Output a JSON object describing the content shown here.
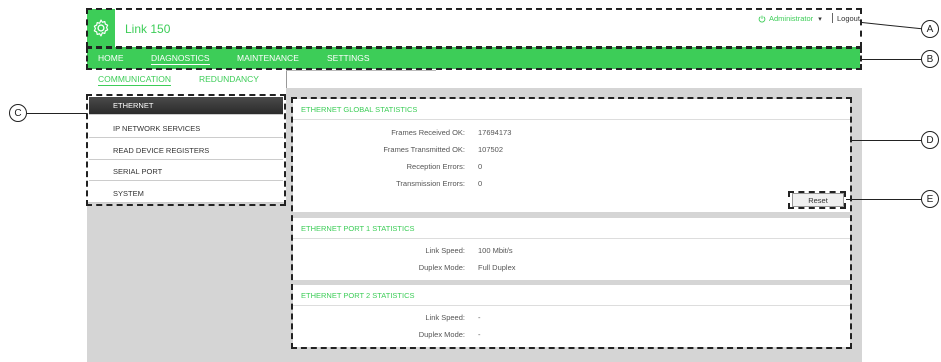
{
  "header": {
    "title": "Link 150",
    "user": "Administrator",
    "logout": "Logout",
    "icons": {
      "logo": "gear-icon",
      "user": "user-power-icon",
      "caret": "caret-down-icon"
    }
  },
  "nav": {
    "items": [
      "HOME",
      "DIAGNOSTICS",
      "MAINTENANCE",
      "SETTINGS"
    ],
    "active": "DIAGNOSTICS"
  },
  "subtabs": {
    "items": [
      "COMMUNICATION",
      "REDUNDANCY"
    ],
    "active": "COMMUNICATION"
  },
  "sidebar": {
    "items": [
      "ETHERNET",
      "IP NETWORK SERVICES",
      "READ DEVICE REGISTERS",
      "SERIAL PORT",
      "SYSTEM"
    ],
    "active": "ETHERNET"
  },
  "global_stats": {
    "title": "ETHERNET GLOBAL STATISTICS",
    "rows": [
      {
        "label": "Frames Received OK:",
        "value": "17694173"
      },
      {
        "label": "Frames Transmitted OK:",
        "value": "107502"
      },
      {
        "label": "Reception Errors:",
        "value": "0"
      },
      {
        "label": "Transmission Errors:",
        "value": "0"
      }
    ],
    "reset_label": "Reset"
  },
  "port1": {
    "title": "ETHERNET PORT 1 STATISTICS",
    "rows": [
      {
        "label": "Link Speed:",
        "value": "100 Mbit/s"
      },
      {
        "label": "Duplex Mode:",
        "value": "Full Duplex"
      }
    ]
  },
  "port2": {
    "title": "ETHERNET PORT 2 STATISTICS",
    "rows": [
      {
        "label": "Link Speed:",
        "value": "-"
      },
      {
        "label": "Duplex Mode:",
        "value": "-"
      }
    ]
  },
  "callouts": [
    "A",
    "B",
    "C",
    "D",
    "E"
  ],
  "colors": {
    "brand": "#3dcd58",
    "active_item": "#2b2b2b",
    "background_gray": "#d5d5d5"
  }
}
